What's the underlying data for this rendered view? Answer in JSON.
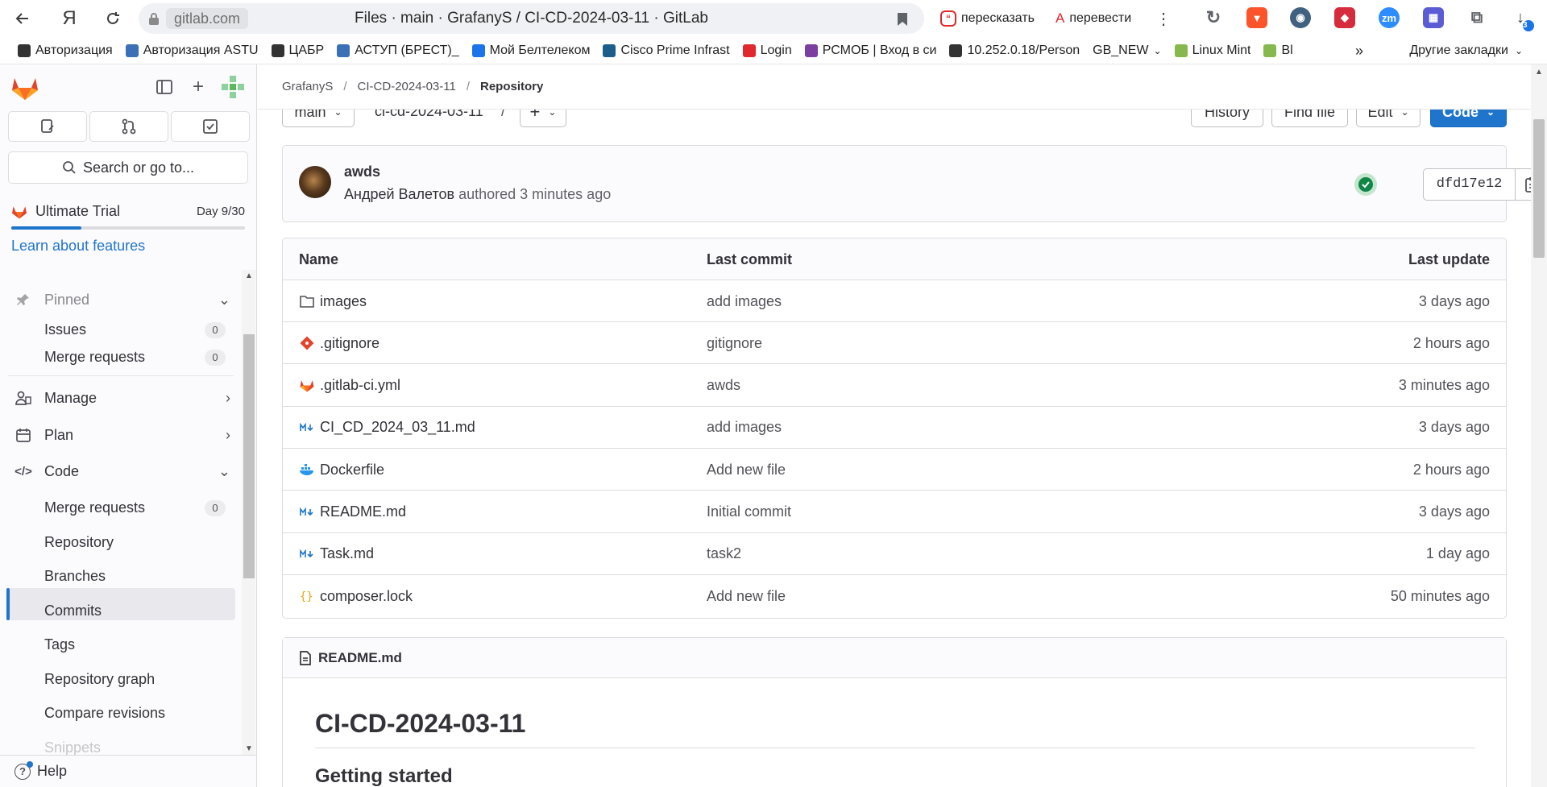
{
  "browser": {
    "url": "gitlab.com",
    "tab_title": "Files · main · GrafanyS / CI-CD-2024-03-11 · GitLab",
    "retell_label": "пересказать",
    "translate_label": "перевести",
    "downloads_count": "3"
  },
  "bookmarks": [
    {
      "label": "Авторизация",
      "color": "#333333"
    },
    {
      "label": "Авторизация ASTU",
      "color": "#3b6fb6"
    },
    {
      "label": "ЦАБР",
      "color": "#333333"
    },
    {
      "label": "АСТУП (БРЕСТ)_",
      "color": "#3b6fb6"
    },
    {
      "label": "Мой Белтелеком",
      "color": "#1a73e8"
    },
    {
      "label": "Cisco Prime Infrast",
      "color": "#1b5e8c"
    },
    {
      "label": "Login",
      "color": "#e0282e"
    },
    {
      "label": "РСМОБ | Вход в си",
      "color": "#7b3fa0"
    },
    {
      "label": "10.252.0.18/Person",
      "color": "#333333"
    },
    {
      "label": "GB_NEW",
      "color": "#ffffff"
    },
    {
      "label": "Linux Mint",
      "color": "#87b84d"
    },
    {
      "label": "Bl",
      "color": "#87b84d"
    }
  ],
  "bookmarks_other": "Другие закладки",
  "sidebar": {
    "search_label": "Search or go to...",
    "trial_label": "Ultimate Trial",
    "trial_day": "Day 9/30",
    "trial_progress": 0.3,
    "trial_link": "Learn about features",
    "pinned_label": "Pinned",
    "pinned_items": [
      {
        "label": "Issues",
        "count": "0"
      },
      {
        "label": "Merge requests",
        "count": "0"
      }
    ],
    "sections": [
      {
        "label": "Manage"
      },
      {
        "label": "Plan"
      },
      {
        "label": "Code"
      }
    ],
    "code_items": [
      {
        "label": "Merge requests",
        "count": "0"
      },
      {
        "label": "Repository"
      },
      {
        "label": "Branches"
      },
      {
        "label": "Commits"
      },
      {
        "label": "Tags"
      },
      {
        "label": "Repository graph"
      },
      {
        "label": "Compare revisions"
      },
      {
        "label": "Snippets"
      }
    ],
    "help_label": "Help"
  },
  "breadcrumb": {
    "group": "GrafanyS",
    "project": "CI-CD-2024-03-11",
    "current": "Repository"
  },
  "controls": {
    "branch": "main",
    "path": "ci-cd-2024-03-11",
    "path_sep": "/",
    "add": "+",
    "history": "History",
    "find_file": "Find file",
    "edit": "Edit",
    "code": "Code"
  },
  "commit": {
    "title": "awds",
    "author": "Андрей Валетов",
    "meta": " authored 3 minutes ago",
    "sha": "dfd17e12"
  },
  "table": {
    "headers": {
      "name": "Name",
      "last_commit": "Last commit",
      "last_update": "Last update"
    },
    "rows": [
      {
        "name": "images",
        "icon": "folder-icon",
        "commit": "add images",
        "update": "3 days ago"
      },
      {
        "name": ".gitignore",
        "icon": "git-icon",
        "commit": "gitignore",
        "update": "2 hours ago"
      },
      {
        "name": ".gitlab-ci.yml",
        "icon": "gitlab-icon",
        "commit": "awds",
        "update": "3 minutes ago"
      },
      {
        "name": "CI_CD_2024_03_11.md",
        "icon": "markdown-icon",
        "commit": "add images",
        "update": "3 days ago"
      },
      {
        "name": "Dockerfile",
        "icon": "docker-icon",
        "commit": "Add new file",
        "update": "2 hours ago"
      },
      {
        "name": "README.md",
        "icon": "markdown-icon",
        "commit": "Initial commit",
        "update": "3 days ago"
      },
      {
        "name": "Task.md",
        "icon": "markdown-icon",
        "commit": "task2",
        "update": "1 day ago"
      },
      {
        "name": "composer.lock",
        "icon": "json-icon",
        "commit": "Add new file",
        "update": "50 minutes ago"
      }
    ]
  },
  "readme": {
    "file": "README.md",
    "h1": "CI-CD-2024-03-11",
    "h2": "Getting started"
  },
  "colors": {
    "accent": "#1f75cb",
    "success": "#108548",
    "gitlab_orange": "#fc6d26"
  }
}
